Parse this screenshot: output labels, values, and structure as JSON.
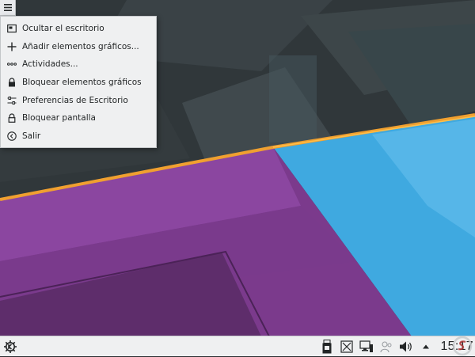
{
  "desktop_menu": {
    "items": [
      {
        "label": "Ocultar el escritorio",
        "icon": "show-desktop-icon"
      },
      {
        "label": "Añadir elementos gráficos...",
        "icon": "add-icon"
      },
      {
        "label": "Actividades...",
        "icon": "activities-icon"
      },
      {
        "label": "Bloquear elementos gráficos",
        "icon": "lock-icon"
      },
      {
        "label": "Preferencias de Escritorio",
        "icon": "settings-sliders-icon"
      },
      {
        "label": "Bloquear pantalla",
        "icon": "unlock-icon"
      },
      {
        "label": "Salir",
        "icon": "logout-icon"
      }
    ]
  },
  "panel": {
    "launcher_icon": "kde-logo-icon",
    "tray_icons": [
      "usb-device-icon",
      "screenshot-icon",
      "network-icon",
      "user-switch-icon",
      "volume-icon",
      "expand-arrow-icon"
    ],
    "clock": "15:17"
  },
  "colors": {
    "accent_orange": "#f0a030",
    "purple": "#7b3a8c",
    "sky_blue": "#3fa9e0",
    "panel_bg": "#eff0f1"
  }
}
